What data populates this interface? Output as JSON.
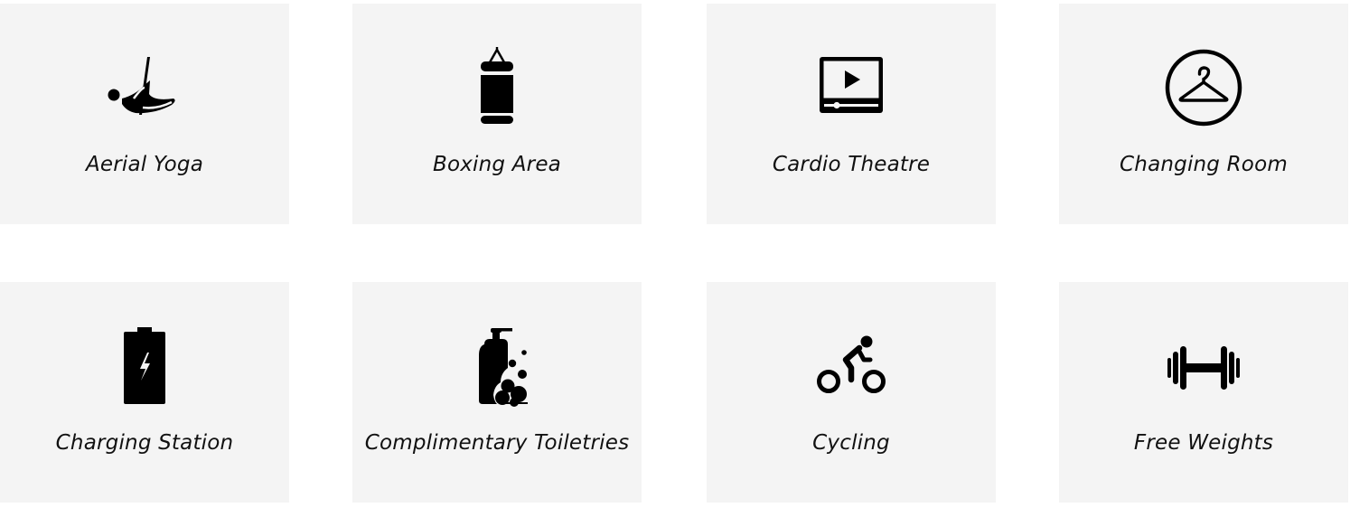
{
  "amenities": [
    {
      "label": "Aerial Yoga",
      "icon": "aerial-yoga-icon"
    },
    {
      "label": "Boxing Area",
      "icon": "punching-bag-icon"
    },
    {
      "label": "Cardio Theatre",
      "icon": "video-player-icon"
    },
    {
      "label": "Changing Room",
      "icon": "clothes-hanger-icon"
    },
    {
      "label": "Charging Station",
      "icon": "battery-charging-icon"
    },
    {
      "label": "Complimentary Toiletries",
      "icon": "soap-dispenser-icon"
    },
    {
      "label": "Cycling",
      "icon": "cyclist-icon"
    },
    {
      "label": "Free Weights",
      "icon": "dumbbell-icon"
    }
  ],
  "colors": {
    "tile_background": "#f4f4f4",
    "icon": "#000000",
    "text": "#111111"
  }
}
